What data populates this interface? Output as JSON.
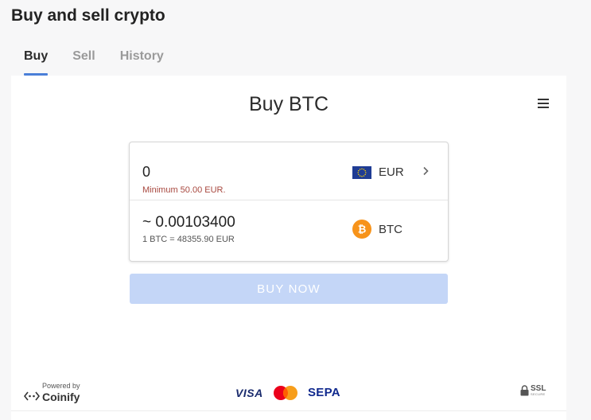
{
  "page": {
    "title": "Buy and sell crypto"
  },
  "tabs": [
    {
      "label": "Buy",
      "active": true
    },
    {
      "label": "Sell",
      "active": false
    },
    {
      "label": "History",
      "active": false
    }
  ],
  "widget": {
    "title": "Buy BTC",
    "menu_icon": "hamburger-menu-icon",
    "fiat": {
      "amount": "0",
      "currency": "EUR",
      "minimum_note": "Minimum 50.00 EUR.",
      "icon": "eu-flag-icon"
    },
    "crypto": {
      "amount": "~ 0.00103400",
      "currency": "BTC",
      "rate_note": "1 BTC = 48355.90 EUR",
      "icon": "bitcoin-icon"
    },
    "buy_button": {
      "label": "BUY NOW",
      "disabled": true
    }
  },
  "footer": {
    "powered_by": "Powered by",
    "provider": "Coinify",
    "payments": [
      "VISA",
      "mastercard",
      "SEPA"
    ],
    "ssl_label": "SSL",
    "ssl_sub": "SECURE"
  },
  "colors": {
    "accent": "#4a7fd8",
    "button_disabled": "#c4d6f7",
    "error_text": "#a8483f",
    "bitcoin": "#f7931a"
  }
}
